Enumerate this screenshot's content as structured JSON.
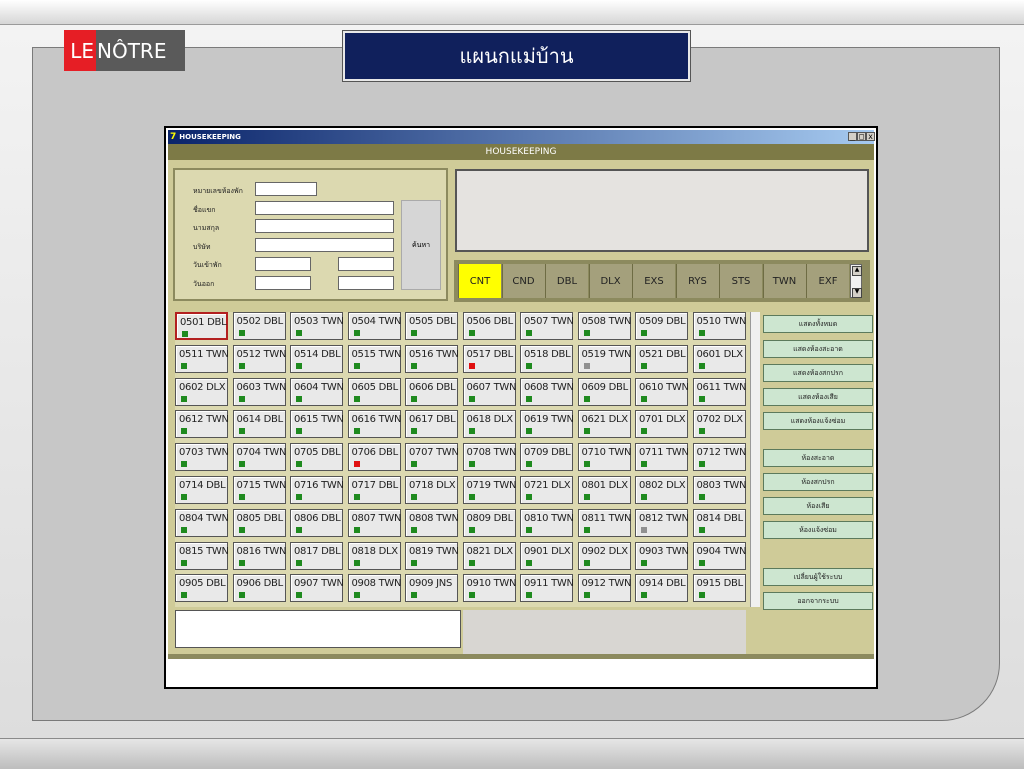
{
  "logo": {
    "le": "LE",
    "notre": "NÔTRE"
  },
  "slide_title": "แผนกแม่บ้าน",
  "window": {
    "title": "HOUSEKEEPING",
    "app_icon": "7",
    "min": "_",
    "max": "□",
    "close": "x"
  },
  "header": "HOUSEKEEPING",
  "search": {
    "room_label": "หมายเลขห้องพัก",
    "guest_label": "ชื่อแขก",
    "surname_label": "นามสกุล",
    "company_label": "บริษัท",
    "checkin_label": "วันเข้าพัก",
    "checkout_label": "วันออก",
    "search_button": "ค้นหา"
  },
  "filters": [
    "CNT",
    "CND",
    "DBL",
    "DLX",
    "EXS",
    "RYS",
    "STS",
    "TWN",
    "EXF"
  ],
  "active_filter": "CNT",
  "status_colors": {
    "green": "#1f8a1f",
    "red": "#e01010",
    "grey": "#909090"
  },
  "rooms": [
    [
      "0501 DBL",
      "g"
    ],
    [
      "0502 DBL",
      "g"
    ],
    [
      "0503 TWN",
      "g"
    ],
    [
      "0504 TWN",
      "g"
    ],
    [
      "0505 DBL",
      "g"
    ],
    [
      "0506 DBL",
      "g"
    ],
    [
      "0507 TWN",
      "g"
    ],
    [
      "0508 TWN",
      "g"
    ],
    [
      "0509 DBL",
      "g"
    ],
    [
      "0510 TWN",
      "g"
    ],
    [
      "0511 TWN",
      "g"
    ],
    [
      "0512 TWN",
      "g"
    ],
    [
      "0514 DBL",
      "g"
    ],
    [
      "0515 TWN",
      "g"
    ],
    [
      "0516 TWN",
      "g"
    ],
    [
      "0517 DBL",
      "r"
    ],
    [
      "0518 DBL",
      "g"
    ],
    [
      "0519 TWN",
      "x"
    ],
    [
      "0521 DBL",
      "g"
    ],
    [
      "0601 DLX",
      "g"
    ],
    [
      "0602 DLX",
      "g"
    ],
    [
      "0603 TWN",
      "g"
    ],
    [
      "0604 TWN",
      "g"
    ],
    [
      "0605 DBL",
      "g"
    ],
    [
      "0606 DBL",
      "g"
    ],
    [
      "0607 TWN",
      "g"
    ],
    [
      "0608 TWN",
      "g"
    ],
    [
      "0609 DBL",
      "g"
    ],
    [
      "0610 TWN",
      "g"
    ],
    [
      "0611 TWN",
      "g"
    ],
    [
      "0612 TWN",
      "g"
    ],
    [
      "0614 DBL",
      "g"
    ],
    [
      "0615 TWN",
      "g"
    ],
    [
      "0616 TWN",
      "g"
    ],
    [
      "0617 DBL",
      "g"
    ],
    [
      "0618 DLX",
      "g"
    ],
    [
      "0619 TWN",
      "g"
    ],
    [
      "0621 DLX",
      "g"
    ],
    [
      "0701 DLX",
      "g"
    ],
    [
      "0702 DLX",
      "g"
    ],
    [
      "0703 TWN",
      "g"
    ],
    [
      "0704 TWN",
      "g"
    ],
    [
      "0705 DBL",
      "g"
    ],
    [
      "0706 DBL",
      "r"
    ],
    [
      "0707 TWN",
      "g"
    ],
    [
      "0708 TWN",
      "g"
    ],
    [
      "0709 DBL",
      "g"
    ],
    [
      "0710 TWN",
      "g"
    ],
    [
      "0711 TWN",
      "g"
    ],
    [
      "0712 TWN",
      "g"
    ],
    [
      "0714 DBL",
      "g"
    ],
    [
      "0715 TWN",
      "g"
    ],
    [
      "0716 TWN",
      "g"
    ],
    [
      "0717 DBL",
      "g"
    ],
    [
      "0718 DLX",
      "g"
    ],
    [
      "0719 TWN",
      "g"
    ],
    [
      "0721 DLX",
      "g"
    ],
    [
      "0801 DLX",
      "g"
    ],
    [
      "0802 DLX",
      "g"
    ],
    [
      "0803 TWN",
      "g"
    ],
    [
      "0804 TWN",
      "g"
    ],
    [
      "0805 DBL",
      "g"
    ],
    [
      "0806 DBL",
      "g"
    ],
    [
      "0807 TWN",
      "g"
    ],
    [
      "0808 TWN",
      "g"
    ],
    [
      "0809 DBL",
      "g"
    ],
    [
      "0810 TWN",
      "g"
    ],
    [
      "0811 TWN",
      "g"
    ],
    [
      "0812 TWN",
      "x"
    ],
    [
      "0814 DBL",
      "g"
    ],
    [
      "0815 TWN",
      "g"
    ],
    [
      "0816 TWN",
      "g"
    ],
    [
      "0817 DBL",
      "g"
    ],
    [
      "0818 DLX",
      "g"
    ],
    [
      "0819 TWN",
      "g"
    ],
    [
      "0821 DLX",
      "g"
    ],
    [
      "0901 DLX",
      "g"
    ],
    [
      "0902 DLX",
      "g"
    ],
    [
      "0903 TWN",
      "g"
    ],
    [
      "0904 TWN",
      "g"
    ],
    [
      "0905 DBL",
      "g"
    ],
    [
      "0906 DBL",
      "g"
    ],
    [
      "0907 TWN",
      "g"
    ],
    [
      "0908 TWN",
      "g"
    ],
    [
      "0909 JNS",
      "g"
    ],
    [
      "0910 TWN",
      "g"
    ],
    [
      "0911 TWN",
      "g"
    ],
    [
      "0912 TWN",
      "g"
    ],
    [
      "0914 DBL",
      "g"
    ],
    [
      "0915 DBL",
      "g"
    ]
  ],
  "actions": {
    "show_all": "แสดงทั้งหมด",
    "show_clean": "แสดงห้องสะอาด",
    "show_dirty": "แสดงห้องสกปรก",
    "show_broken": "แสดงห้องเสีย",
    "show_repair": "แสดงห้องแจ้งซ่อม",
    "clean": "ห้องสะอาด",
    "dirty": "ห้องสกปรก",
    "broken": "ห้องเสีย",
    "repair": "ห้องแจ้งซ่อม",
    "change_user": "เปลี่ยนผู้ใช้ระบบ",
    "logout": "ออกจากระบบ"
  }
}
